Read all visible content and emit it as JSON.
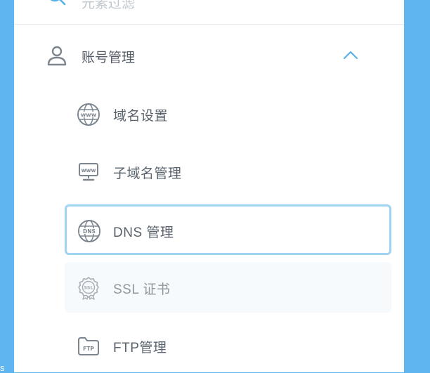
{
  "search": {
    "text": "元素过滤",
    "icon": "search-icon"
  },
  "group": {
    "title": "账号管理",
    "icon": "user-icon",
    "expand_icon": "chevron-up-icon"
  },
  "menu": [
    {
      "label": "域名设置",
      "icon": "www-globe-icon"
    },
    {
      "label": "子域名管理",
      "icon": "www-monitor-icon"
    },
    {
      "label": "DNS 管理",
      "icon": "dns-globe-icon",
      "state": "selected"
    },
    {
      "label": "SSL 证书",
      "icon": "ssl-badge-icon",
      "state": "hover"
    },
    {
      "label": "FTP管理",
      "icon": "ftp-folder-icon"
    }
  ],
  "icon_text": {
    "www": "www",
    "dns": "DNS",
    "ssl": "SSL",
    "ftp": "FTP"
  },
  "colors": {
    "background": "#5eb5f0",
    "panel": "#ffffff",
    "selected_border": "#9fd4f3",
    "accent": "#5ab0e8",
    "icon": "#7d868f",
    "text": "#5a636d"
  },
  "edge_text": "s"
}
